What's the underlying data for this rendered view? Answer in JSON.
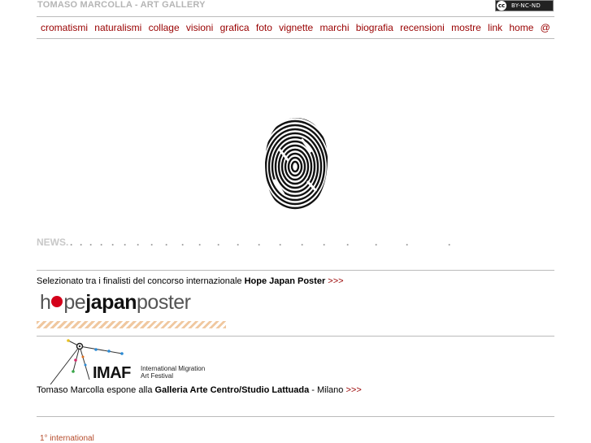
{
  "site": {
    "title": "TOMASO MARCOLLA - ART GALLERY",
    "license_badge": "BY-NC-ND",
    "license_symbol": "cc"
  },
  "nav": {
    "items": [
      {
        "label": "cromatismi"
      },
      {
        "label": "naturalismi"
      },
      {
        "label": "collage"
      },
      {
        "label": "visioni"
      },
      {
        "label": "grafica"
      },
      {
        "label": "foto"
      },
      {
        "label": "vignette"
      },
      {
        "label": "marchi"
      },
      {
        "label": "biografia"
      },
      {
        "label": "recensioni"
      },
      {
        "label": "mostre"
      },
      {
        "label": "link"
      },
      {
        "label": "home"
      },
      {
        "label": "@"
      }
    ],
    "color": "#990000"
  },
  "news": {
    "heading": "NEWS.",
    "items": [
      {
        "text_before": "Selezionato tra i finalisti del concorso internazionale ",
        "bold": "Hope Japan Poster",
        "text_after": "",
        "more": ">>>",
        "logo": {
          "part1": "h",
          "part2": "pe",
          "part3": "japan",
          "part4": "poster"
        }
      },
      {
        "text_before": "Tomaso Marcolla espone alla ",
        "bold": "Galleria Arte Centro/Studio Lattuada",
        "text_after": " - Milano ",
        "more": ">>>",
        "logo": {
          "name": "IMAF",
          "line1": "International Migration",
          "line2": "Art Festival"
        }
      }
    ],
    "third_item_partial": "1° international"
  },
  "colors": {
    "accent": "#990000",
    "hope_red": "#d4001a",
    "stripe": "#f0c8a0"
  },
  "icons": {
    "fingerprint": "fingerprint-icon",
    "cc": "creative-commons-icon"
  }
}
